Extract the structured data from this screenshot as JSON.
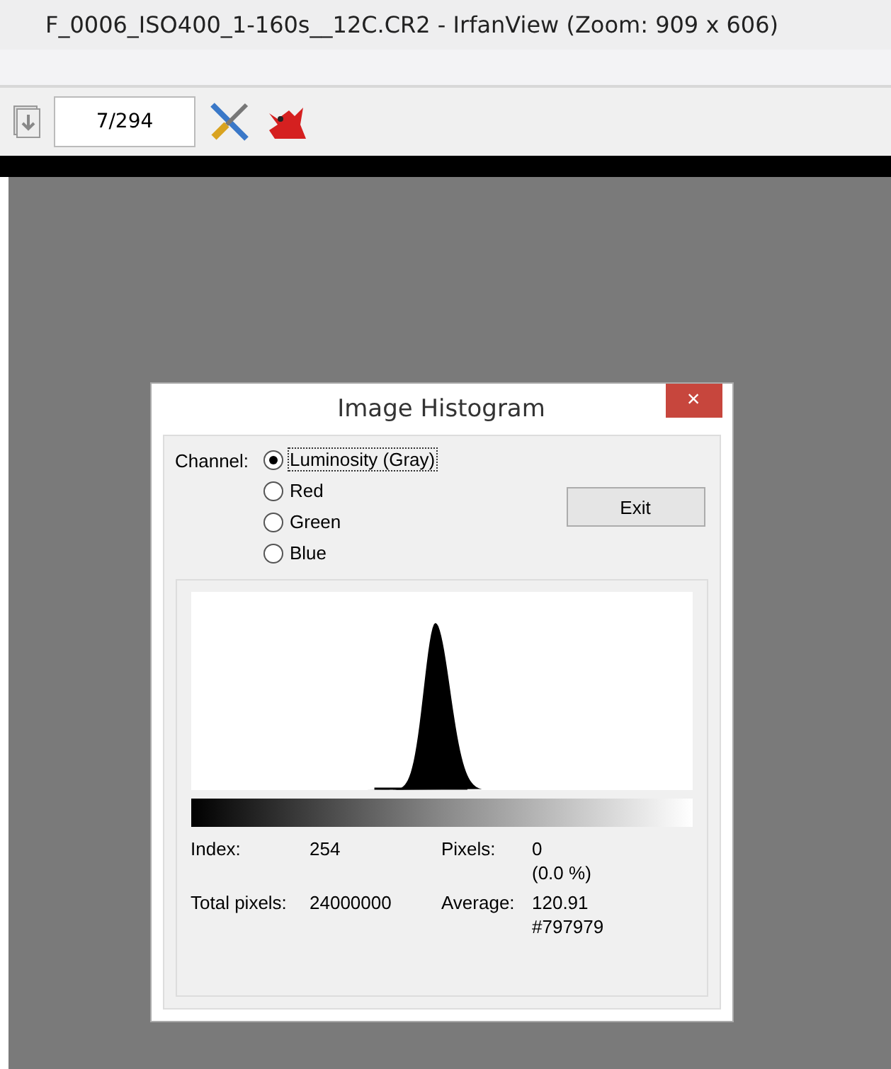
{
  "window": {
    "title": "F_0006_ISO400_1-160s__12C.CR2 - IrfanView (Zoom: 909 x 606)"
  },
  "toolbar": {
    "page_counter": "7/294"
  },
  "dialog": {
    "title": "Image Histogram",
    "close": "×",
    "channel_label": "Channel:",
    "channels": [
      {
        "label": "Luminosity (Gray)",
        "selected": true
      },
      {
        "label": "Red",
        "selected": false
      },
      {
        "label": "Green",
        "selected": false
      },
      {
        "label": "Blue",
        "selected": false
      }
    ],
    "exit_button": "Exit",
    "stats": [
      {
        "label": "Index:",
        "values": [
          "254"
        ]
      },
      {
        "label": "Pixels:",
        "values": [
          "0",
          "(0.0 %)"
        ]
      },
      {
        "label": "Total pixels:",
        "values": [
          "24000000"
        ]
      },
      {
        "label": "Average:",
        "values": [
          "120.91",
          "#797979"
        ]
      }
    ]
  }
}
